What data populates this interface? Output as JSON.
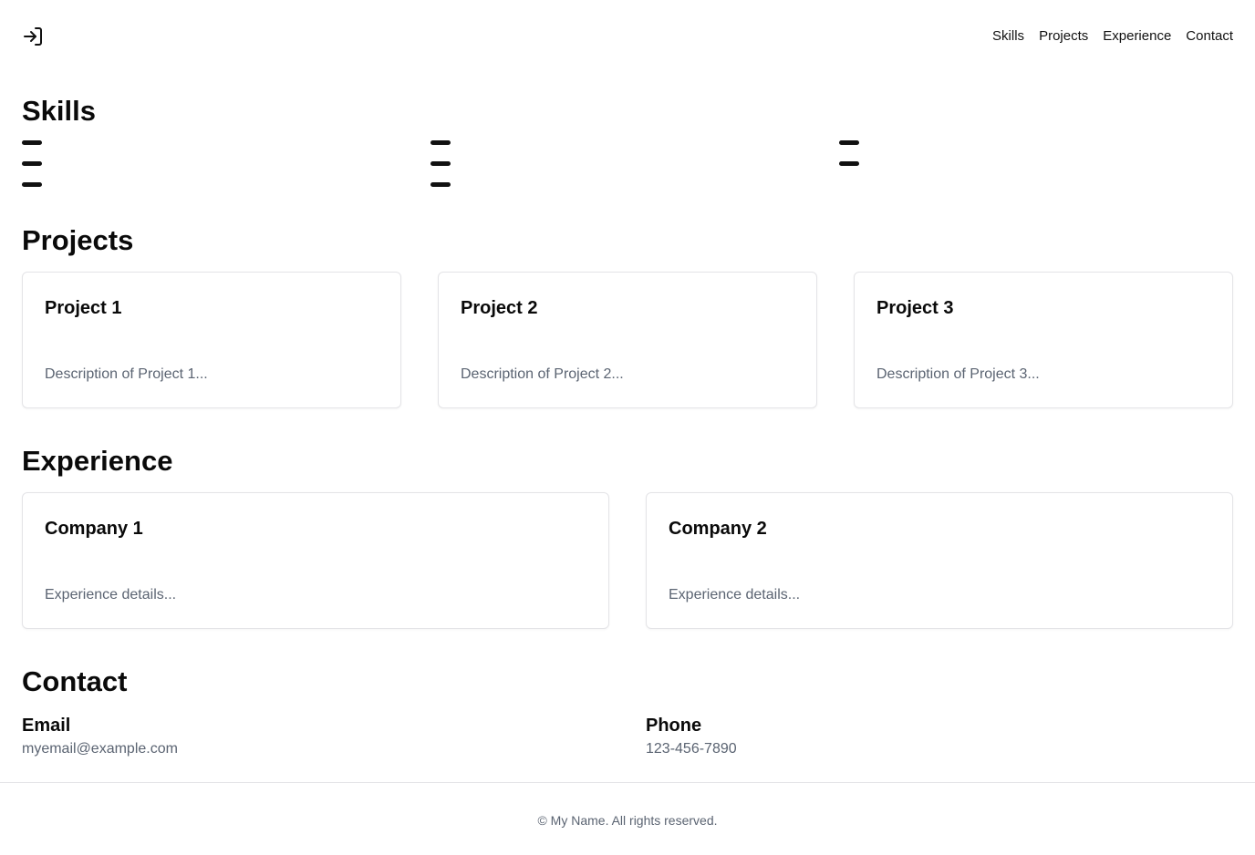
{
  "header": {
    "logo_icon": "login-arrow-icon",
    "nav": [
      "Skills",
      "Projects",
      "Experience",
      "Contact"
    ]
  },
  "skills": {
    "title": "Skills",
    "columns": [
      {
        "bars": 3
      },
      {
        "bars": 3
      },
      {
        "bars": 2
      }
    ]
  },
  "projects": {
    "title": "Projects",
    "items": [
      {
        "title": "Project 1",
        "description": "Description of Project 1..."
      },
      {
        "title": "Project 2",
        "description": "Description of Project 2..."
      },
      {
        "title": "Project 3",
        "description": "Description of Project 3..."
      }
    ]
  },
  "experience": {
    "title": "Experience",
    "items": [
      {
        "title": "Company 1",
        "description": "Experience details..."
      },
      {
        "title": "Company 2",
        "description": "Experience details..."
      }
    ]
  },
  "contact": {
    "title": "Contact",
    "email_label": "Email",
    "email_value": "myemail@example.com",
    "phone_label": "Phone",
    "phone_value": "123-456-7890"
  },
  "footer": {
    "text": "© My Name. All rights reserved."
  },
  "colors": {
    "text": "#111111",
    "muted": "#5b6472",
    "border": "#e4e4e7"
  }
}
